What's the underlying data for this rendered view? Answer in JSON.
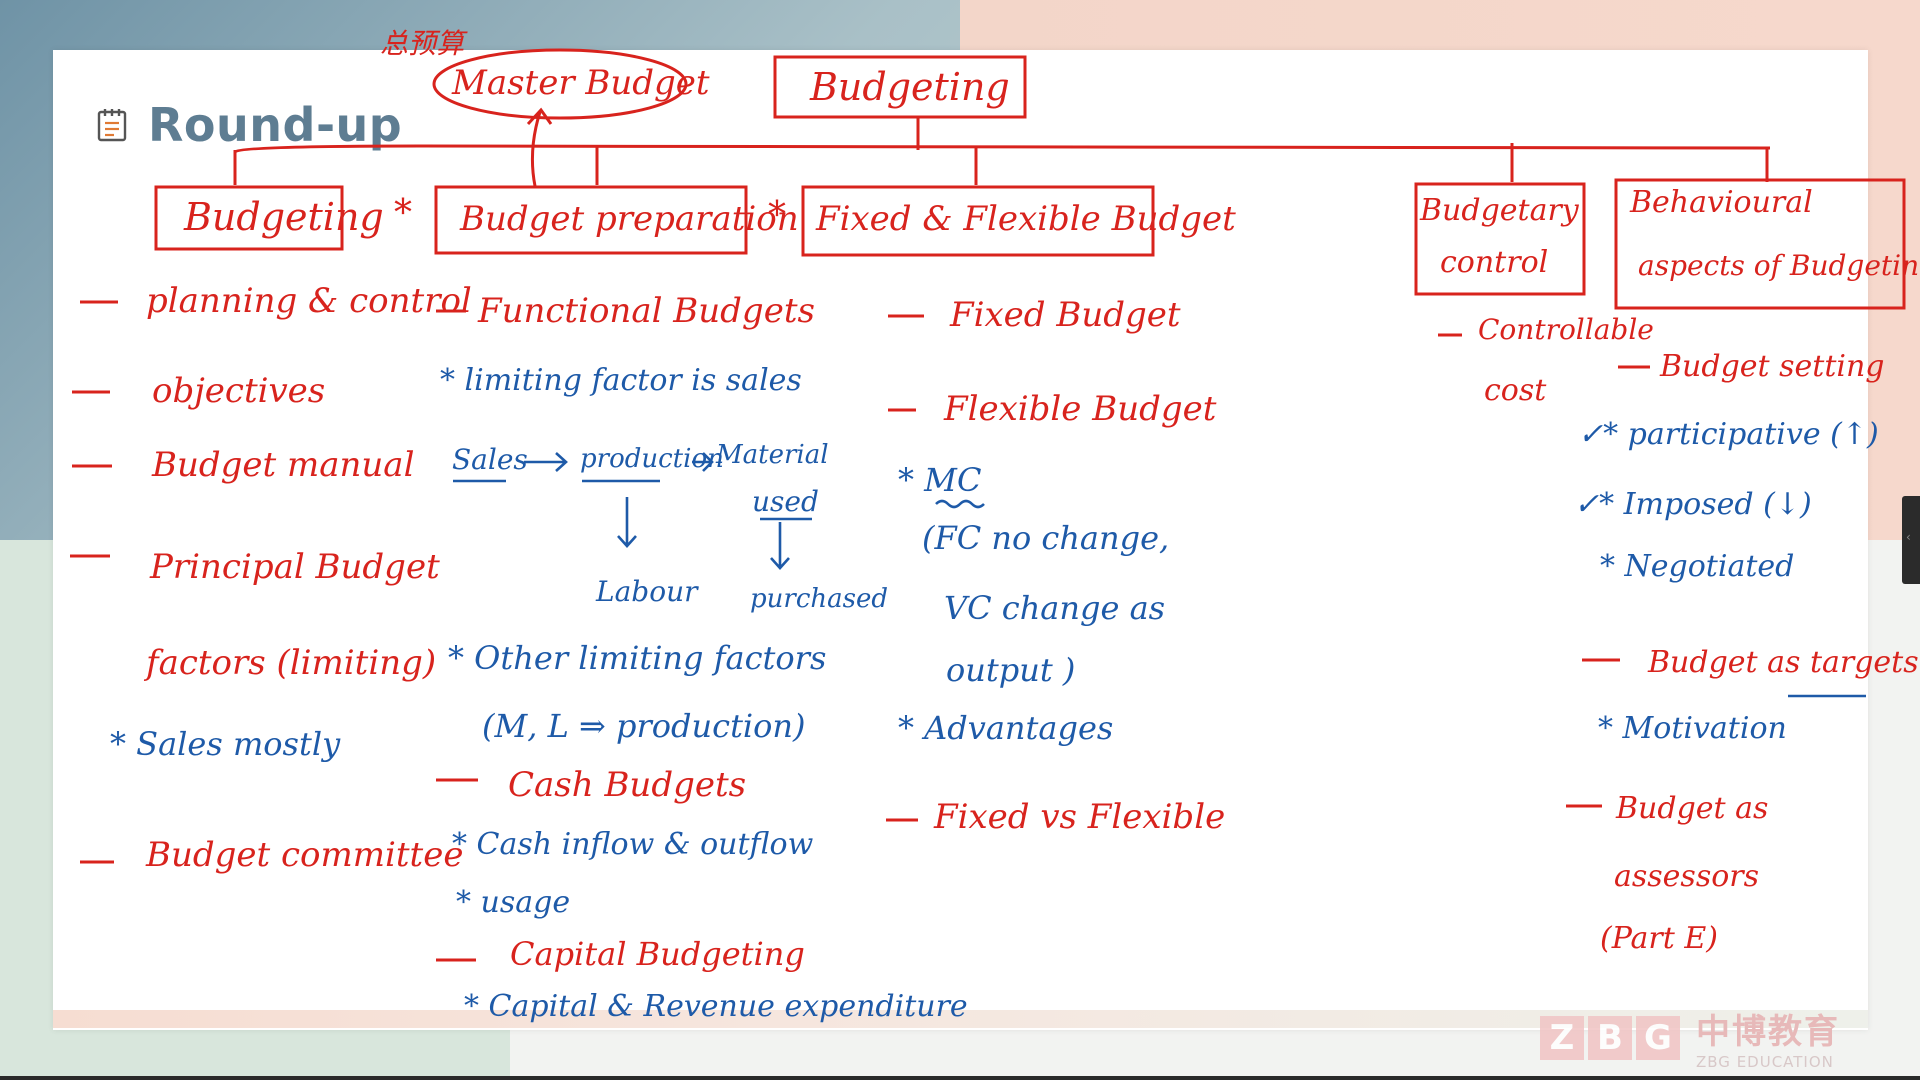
{
  "slide": {
    "title": "Round-up",
    "title_icon": "notepad-icon"
  },
  "annotations": {
    "master_budget_note": "总预算",
    "master_budget": "Master Budget",
    "budgeting_root": "Budgeting",
    "columns": {
      "budgeting": {
        "header": "Budgeting",
        "items": [
          "planning & control",
          "objectives",
          "Budget manual",
          "Principal Budget",
          "factors (limiting)",
          "Budget committee"
        ],
        "notes": [
          "* Sales mostly"
        ]
      },
      "budget_preparation": {
        "header": "Budget preparation",
        "items": [
          "Functional Budgets",
          "Cash Budgets",
          "Capital Budgeting"
        ],
        "notes": [
          "* limiting factor is sales",
          "Sales",
          "production",
          "Material",
          "used",
          "Labour",
          "purchased",
          "* Other limiting factors",
          "(M, L ⇒ production)",
          "* Cash inflow & outflow",
          "* usage",
          "* Capital & Revenue expenditure"
        ]
      },
      "fixed_flexible": {
        "header": "Fixed & Flexible Budget",
        "items": [
          "Fixed Budget",
          "Flexible Budget",
          "Fixed vs Flexible"
        ],
        "notes": [
          "* MC",
          "(FC no change,",
          "VC change as",
          "output )",
          "* Advantages"
        ]
      },
      "budgetary_control": {
        "header_line1": "Budgetary",
        "header_line2": "control",
        "items": [
          "Controllable",
          "cost"
        ]
      },
      "behavioural": {
        "header_line1": "Behavioural",
        "header_line2": "aspects of Budgeting",
        "items": [
          "Budget setting",
          "Budget as targets",
          "Budget as",
          "assessors",
          "(Part E)"
        ],
        "notes": [
          "✓* participative (↑)",
          "✓* Imposed (↓)",
          "* Negotiated",
          "* Motivation"
        ]
      }
    }
  },
  "logo": {
    "letters": [
      "Z",
      "B",
      "G"
    ],
    "cn_text": "中博教育",
    "en_text": "ZBG EDUCATION"
  },
  "side_handle": {
    "glyph": "‹"
  },
  "colors": {
    "ink_red": "#d8231d",
    "ink_blue": "#1e5aa8",
    "title": "#5e7d92"
  }
}
